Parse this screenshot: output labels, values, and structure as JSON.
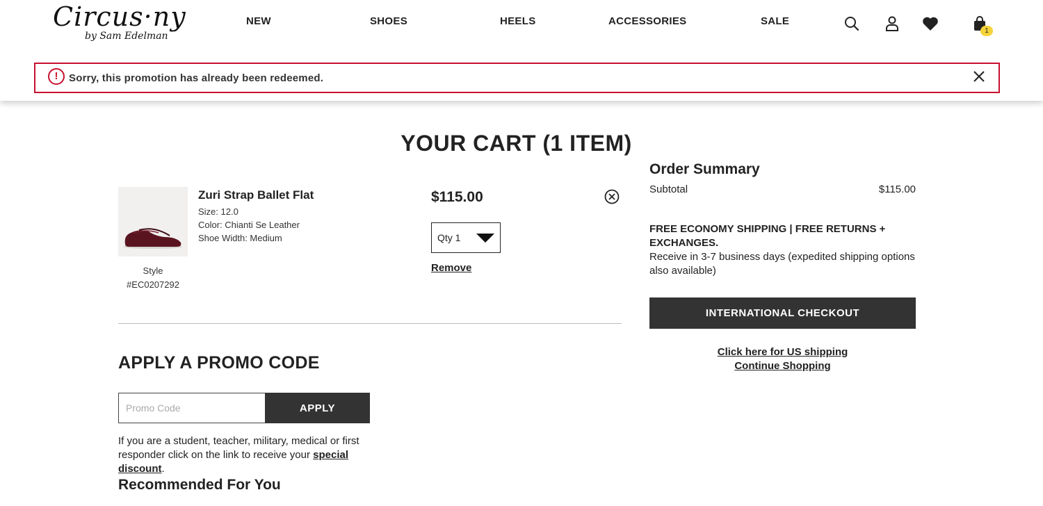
{
  "header": {
    "logo_main": "Circus·ny",
    "logo_sub": "by Sam Edelman",
    "nav": [
      "NEW",
      "SHOES",
      "HEELS",
      "ACCESSORIES",
      "SALE"
    ],
    "cart_count": "1"
  },
  "alert": {
    "icon": "!",
    "message": "Sorry, this promotion has already been redeemed."
  },
  "cart": {
    "title": "YOUR CART (1 ITEM)",
    "item": {
      "name": "Zuri Strap Ballet Flat",
      "size": "Size: 12.0",
      "color": "Color: Chianti Se Leather",
      "width": "Shoe Width: Medium",
      "style_label": "Style",
      "style_code": "#EC0207292",
      "price": "$115.00",
      "qty_label": "Qty 1",
      "remove_label": "Remove"
    }
  },
  "promo": {
    "title": "APPLY A PROMO CODE",
    "placeholder": "Promo Code",
    "apply_label": "APPLY",
    "note_text": "If you are a student, teacher, military, medical or first responder click on the link to receive your",
    "note_link": "special discount",
    "note_end": "."
  },
  "recommended": {
    "title": "Recommended For You"
  },
  "summary": {
    "title": "Order Summary",
    "subtotal_label": "Subtotal",
    "subtotal_value": "$115.00",
    "shipping_bold": "FREE ECONOMY SHIPPING | FREE RETURNS + EXCHANGES.",
    "shipping_detail": "Receive in 3-7 business days (expedited shipping options also available)",
    "checkout_label": "INTERNATIONAL CHECKOUT",
    "us_shipping_link": "Click here for US shipping",
    "continue_link": "Continue Shopping"
  },
  "colors": {
    "alert_border": "#c8102e",
    "button_bg": "#333333",
    "badge": "#f5d33a",
    "product_shoe": "#5a1420"
  }
}
